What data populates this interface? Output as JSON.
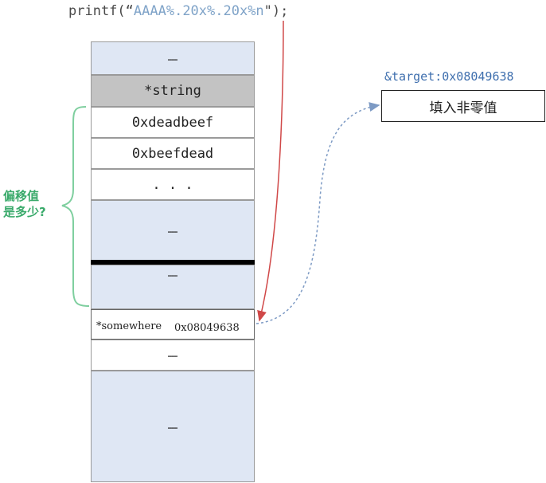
{
  "code": {
    "fn": "printf(",
    "open_quote": "“",
    "fmt": "AAAA%.20x%.20x%n",
    "close": "\");"
  },
  "stack": {
    "top_dots": "……",
    "string_ptr": "*string",
    "val1": "0xdeadbeef",
    "val2": "0xbeefdead",
    "ellipsis": ". . .",
    "blue_dots1": "……",
    "blue_dots2": "……",
    "somewhere_label": "*somewhere",
    "somewhere_addr": "0x08049638",
    "after_dots": "……",
    "bottom_dots": "……"
  },
  "target": {
    "label": "&target:0x08049638",
    "box_text": "填入非零值"
  },
  "offset_question": {
    "line1": "偏移值",
    "line2": "是多少?"
  },
  "colors": {
    "stack_blue": "#dfe7f4",
    "brace_green": "#7fcf9f",
    "arrow_red": "#d04848",
    "arrow_blue": "#7d9ac4",
    "label_blue": "#3f6fae"
  }
}
